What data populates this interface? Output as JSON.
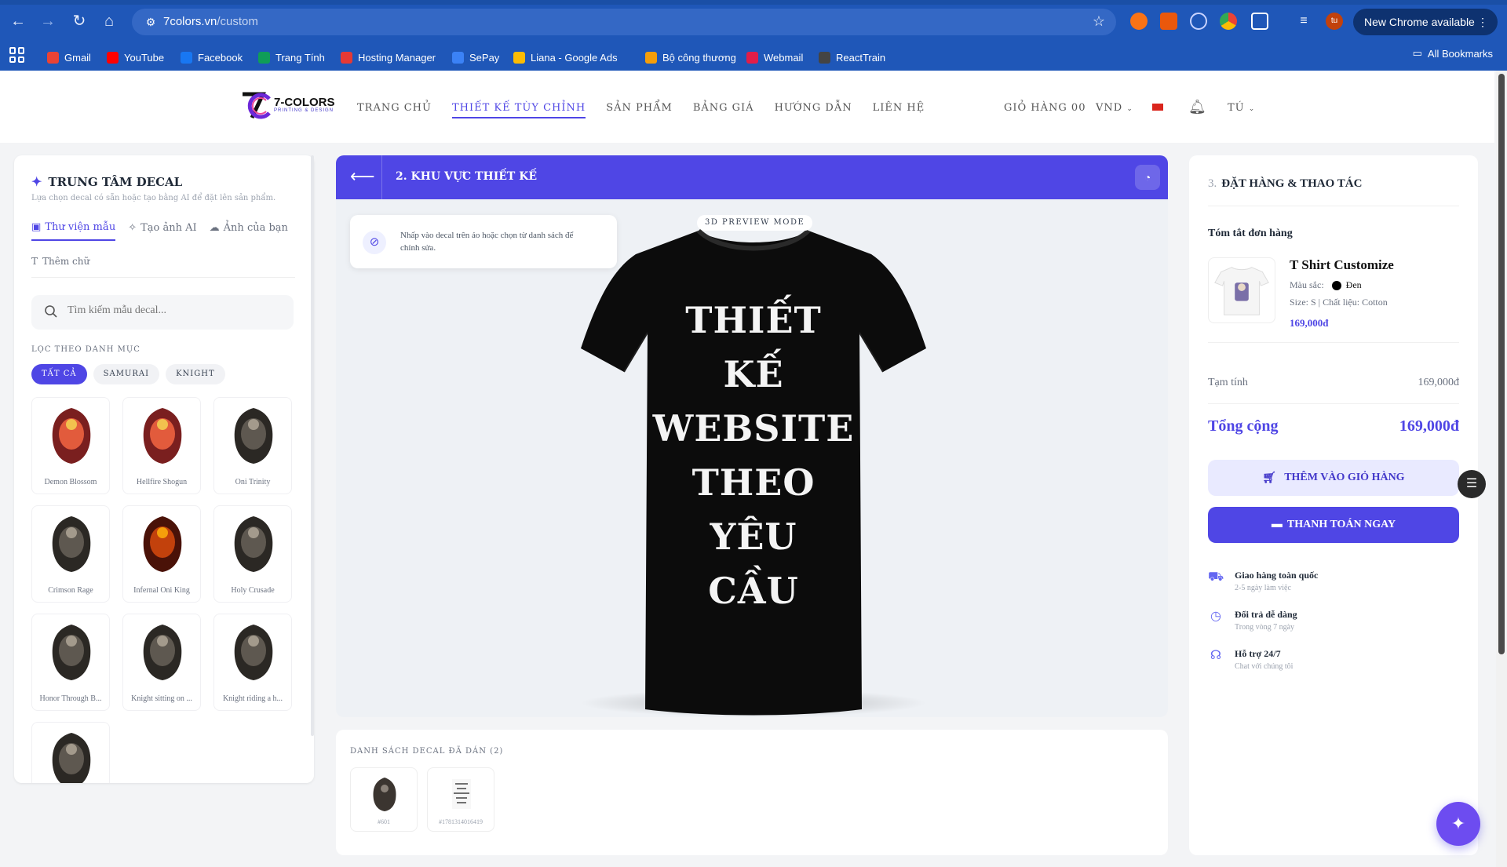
{
  "browser": {
    "url_host": "7colors.vn",
    "url_path": "/custom",
    "new_chrome_label": "New Chrome available",
    "bookmarks": [
      {
        "label": "Gmail",
        "color": "#ea4335"
      },
      {
        "label": "YouTube",
        "color": "#ff0000"
      },
      {
        "label": "Facebook",
        "color": "#1877f2"
      },
      {
        "label": "Trang Tính",
        "color": "#0f9d58"
      },
      {
        "label": "Hosting Manager",
        "color": "#e53935"
      },
      {
        "label": "SePay",
        "color": "#3b82f6"
      },
      {
        "label": "Liana - Google Ads",
        "color": "#fbbc04"
      },
      {
        "label": "Bộ công thương",
        "color": "#f59e0b"
      },
      {
        "label": "Webmail",
        "color": "#e11d48"
      },
      {
        "label": "ReactTrain",
        "color": "#444444"
      }
    ],
    "all_bookmarks_label": "All Bookmarks"
  },
  "site": {
    "logo_text": "7-COLORS",
    "logo_sub": "PRINTING & DESIGN",
    "menu": [
      "TRANG CHỦ",
      "THIẾT KẾ TÙY CHỈNH",
      "SẢN PHẨM",
      "BẢNG GIÁ",
      "HƯỚNG DẪN",
      "LIÊN HỆ"
    ],
    "cart_label": "GIỎ HÀNG 00",
    "currency": "VND",
    "user": "TÚ"
  },
  "left_panel": {
    "title": "TRUNG TÂM DECAL",
    "subtitle": "Lựa chọn decal có sẵn hoặc tạo bằng AI để đặt lên sản phẩm.",
    "tabs": [
      "Thư viện mẫu",
      "Tạo ảnh AI",
      "Ảnh của bạn"
    ],
    "add_text": "Thêm chữ",
    "search_placeholder": "Tìm kiếm mẫu decal...",
    "filter_label": "LỌC THEO DANH MỤC",
    "chips": [
      "TẤT CẢ",
      "SAMURAI",
      "KNIGHT"
    ],
    "decals": [
      {
        "name": "Demon Blossom",
        "style": "red"
      },
      {
        "name": "Hellfire Shogun",
        "style": "red"
      },
      {
        "name": "Oni Trinity",
        "style": "dark"
      },
      {
        "name": "Crimson Rage",
        "style": "dark"
      },
      {
        "name": "Infernal Oni King",
        "style": "fire"
      },
      {
        "name": "Holy Crusade",
        "style": "dark"
      },
      {
        "name": "Honor Through B...",
        "style": "dark"
      },
      {
        "name": "Knight sitting on ...",
        "style": "dark"
      },
      {
        "name": "Knight riding a h...",
        "style": "dark"
      },
      {
        "name": "",
        "style": "dark"
      }
    ]
  },
  "center": {
    "step_title": "2. KHU VỰC THIẾT KẾ",
    "hint": "Nhấp vào decal trên áo hoặc chọn từ danh sách để chỉnh sửa.",
    "preview_badge": "3D PREVIEW MODE",
    "shirt_lines": [
      "THIẾT",
      "KẾ",
      "WEBSITE",
      "THEO",
      "YÊU",
      "CẦU"
    ],
    "applied_title": "DANH SÁCH DECAL ĐÃ DÁN (2)",
    "applied": [
      {
        "id": "#601"
      },
      {
        "id": "#1781314016419"
      }
    ]
  },
  "right_panel": {
    "step_num": "3.",
    "title": "ĐẶT HÀNG & THAO TÁC",
    "summary_label": "Tóm tắt đơn hàng",
    "product_name": "T Shirt Customize",
    "color_label": "Màu sắc:",
    "color_name": "Đen",
    "size_line": "Size: S | Chất liệu: Cotton",
    "price": "169,000đ",
    "subtotal_label": "Tạm tính",
    "subtotal_value": "169,000đ",
    "total_label": "Tổng cộng",
    "total_value": "169,000đ",
    "add_to_cart": "THÊM VÀO GIỎ HÀNG",
    "pay_now": "THANH TOÁN NGAY",
    "features": [
      {
        "title": "Giao hàng toàn quốc",
        "sub": "2-5 ngày làm việc",
        "icon": "truck-icon"
      },
      {
        "title": "Đổi trả dễ dàng",
        "sub": "Trong vòng 7 ngày",
        "icon": "clock-icon"
      },
      {
        "title": "Hỗ trợ 24/7",
        "sub": "Chat với chúng tôi",
        "icon": "headset-icon"
      }
    ]
  },
  "colors": {
    "accent": "#4f46e5",
    "chrome": "#1f57b8",
    "shirt": "#0c0c0c"
  }
}
